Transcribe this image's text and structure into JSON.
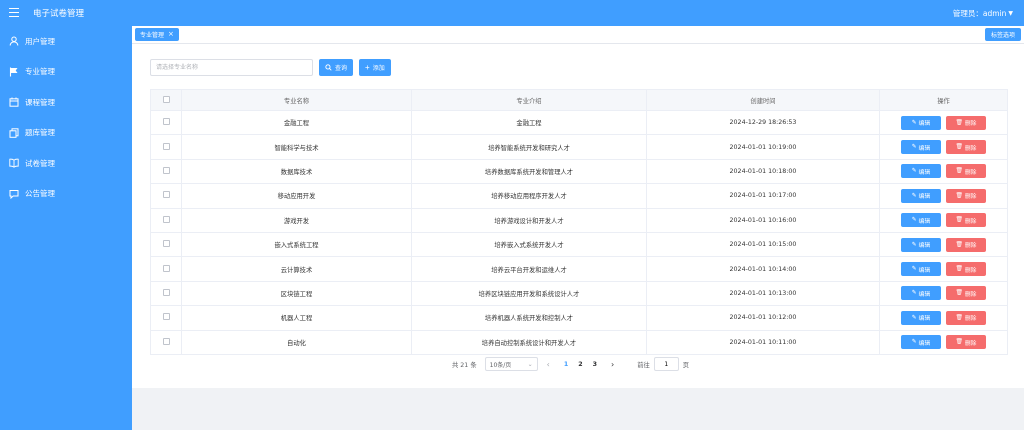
{
  "header": {
    "title": "电子试卷管理",
    "user_label": "管理员：admin"
  },
  "sidebar": {
    "items": [
      {
        "label": "用户管理",
        "icon": "user-icon"
      },
      {
        "label": "专业管理",
        "icon": "flag-icon"
      },
      {
        "label": "课程管理",
        "icon": "calendar-icon"
      },
      {
        "label": "题库管理",
        "icon": "copy-icon"
      },
      {
        "label": "试卷管理",
        "icon": "book-icon"
      },
      {
        "label": "公告管理",
        "icon": "chat-icon"
      }
    ]
  },
  "tabs": {
    "active": "专业管理",
    "close": "×",
    "options": "标签选项"
  },
  "toolbar": {
    "search_placeholder": "请选择专业名称",
    "query_label": "查询",
    "add_label": "添加"
  },
  "table": {
    "headers": [
      "专业名称",
      "专业介绍",
      "创建时间",
      "操作"
    ],
    "rows": [
      {
        "name": "金融工程",
        "intro": "金融工程",
        "time": "2024-12-29 18:26:53"
      },
      {
        "name": "智能科学与技术",
        "intro": "培养智能系统开发和研究人才",
        "time": "2024-01-01 10:19:00"
      },
      {
        "name": "数据库技术",
        "intro": "培养数据库系统开发和管理人才",
        "time": "2024-01-01 10:18:00"
      },
      {
        "name": "移动应用开发",
        "intro": "培养移动应用程序开发人才",
        "time": "2024-01-01 10:17:00"
      },
      {
        "name": "游戏开发",
        "intro": "培养游戏设计和开发人才",
        "time": "2024-01-01 10:16:00"
      },
      {
        "name": "嵌入式系统工程",
        "intro": "培养嵌入式系统开发人才",
        "time": "2024-01-01 10:15:00"
      },
      {
        "name": "云计算技术",
        "intro": "培养云平台开发和运维人才",
        "time": "2024-01-01 10:14:00"
      },
      {
        "name": "区块链工程",
        "intro": "培养区块链应用开发和系统设计人才",
        "time": "2024-01-01 10:13:00"
      },
      {
        "name": "机器人工程",
        "intro": "培养机器人系统开发和控制人才",
        "time": "2024-01-01 10:12:00"
      },
      {
        "name": "自动化",
        "intro": "培养自动控制系统设计和开发人才",
        "time": "2024-01-01 10:11:00"
      }
    ],
    "edit_label": "编辑",
    "delete_label": "删除"
  },
  "pagination": {
    "total": "共 21 条",
    "page_size": "10条/页",
    "pages": [
      "1",
      "2",
      "3"
    ],
    "current": "1",
    "goto_prefix": "前往",
    "goto_value": "1",
    "goto_suffix": "页"
  },
  "colors": {
    "primary": "#409eff",
    "danger": "#f56c6c"
  }
}
